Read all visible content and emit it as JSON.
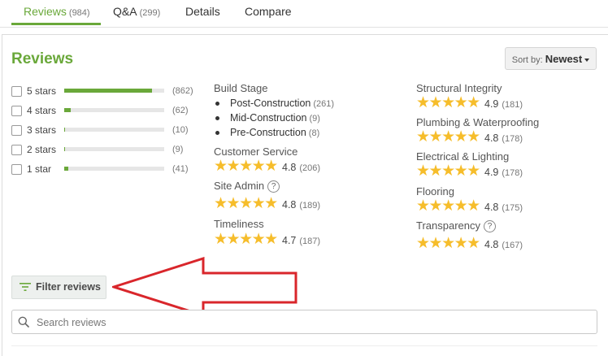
{
  "tabs": [
    {
      "label": "Reviews",
      "count": "(984)",
      "active": true
    },
    {
      "label": "Q&A",
      "count": "(299)",
      "active": false
    },
    {
      "label": "Details",
      "count": "",
      "active": false
    },
    {
      "label": "Compare",
      "count": "",
      "active": false
    }
  ],
  "title": "Reviews",
  "sort": {
    "prefix": "Sort by:",
    "value": "Newest"
  },
  "star_filters": [
    {
      "label": "5 stars",
      "count": "(862)",
      "share": 0.876
    },
    {
      "label": "4 stars",
      "count": "(62)",
      "share": 0.063
    },
    {
      "label": "3 stars",
      "count": "(10)",
      "share": 0.01
    },
    {
      "label": "2 stars",
      "count": "(9)",
      "share": 0.009
    },
    {
      "label": "1 star",
      "count": "(41)",
      "share": 0.042
    }
  ],
  "build_stage": {
    "label": "Build Stage",
    "items": [
      {
        "label": "Post-Construction",
        "count": "(261)"
      },
      {
        "label": "Mid-Construction",
        "count": "(9)"
      },
      {
        "label": "Pre-Construction",
        "count": "(8)"
      }
    ]
  },
  "ratings_left": [
    {
      "label": "Customer Service",
      "value": "4.8",
      "count": "(206)",
      "help": false
    },
    {
      "label": "Site Admin",
      "value": "4.8",
      "count": "(189)",
      "help": true
    },
    {
      "label": "Timeliness",
      "value": "4.7",
      "count": "(187)",
      "help": false
    }
  ],
  "ratings_right": [
    {
      "label": "Structural Integrity",
      "value": "4.9",
      "count": "(181)",
      "help": false
    },
    {
      "label": "Plumbing & Waterproofing",
      "value": "4.8",
      "count": "(178)",
      "help": false
    },
    {
      "label": "Electrical & Lighting",
      "value": "4.9",
      "count": "(178)",
      "help": false
    },
    {
      "label": "Flooring",
      "value": "4.8",
      "count": "(175)",
      "help": false
    },
    {
      "label": "Transparency",
      "value": "4.8",
      "count": "(167)",
      "help": true
    }
  ],
  "stars_glyph": "★★★★★",
  "help_glyph": "?",
  "filter_button": {
    "label": "Filter reviews"
  },
  "search": {
    "placeholder": "Search reviews",
    "value": ""
  },
  "colors": {
    "accent": "#6aa83a",
    "star": "#f6bd2b",
    "annotation_arrow": "#d9262b"
  }
}
